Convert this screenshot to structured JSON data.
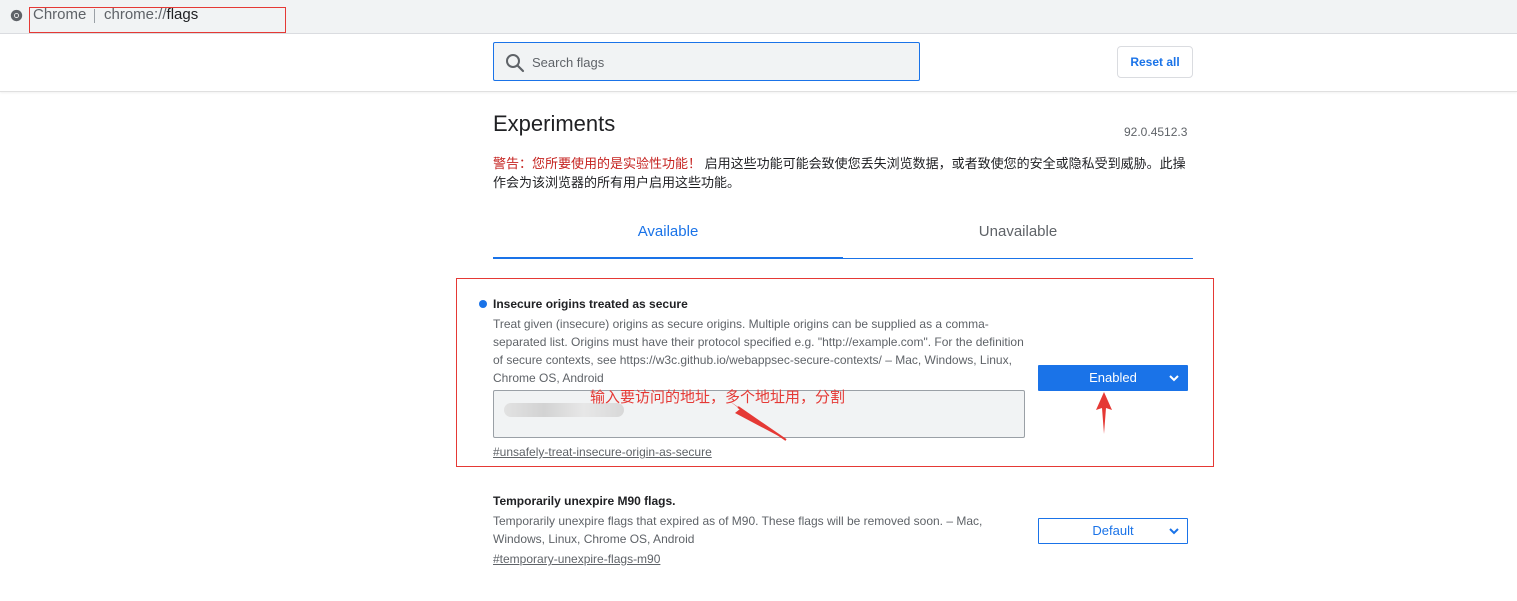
{
  "address_bar": {
    "site_label": "Chrome",
    "url_scheme": "chrome://",
    "url_path": "flags"
  },
  "search": {
    "placeholder": "Search flags",
    "value": ""
  },
  "header": {
    "reset_label": "Reset all"
  },
  "page": {
    "title": "Experiments",
    "version": "92.0.4512.3",
    "warning_lead": "警告：您所要使用的是实验性功能！",
    "warning_body": " 启用这些功能可能会致使您丢失浏览数据，或者致使您的安全或隐私受到威胁。此操作会为该浏览器的所有用户启用这些功能。"
  },
  "tabs": [
    {
      "label": "Available",
      "active": true
    },
    {
      "label": "Unavailable",
      "active": false
    }
  ],
  "flags": [
    {
      "name": "Insecure origins treated as secure",
      "description": "Treat given (insecure) origins as secure origins. Multiple origins can be supplied as a comma-separated list. Origins must have their protocol specified e.g. \"http://example.com\". For the definition of secure contexts, see https://w3c.github.io/webappsec-secure-contexts/ – Mac, Windows, Linux, Chrome OS, Android",
      "link": "#unsafely-treat-insecure-origin-as-secure",
      "state": "Enabled",
      "modified": true
    },
    {
      "name": "Temporarily unexpire M90 flags.",
      "description": "Temporarily unexpire flags that expired as of M90. These flags will be removed soon. – Mac, Windows, Linux, Chrome OS, Android",
      "link": "#temporary-unexpire-flags-m90",
      "state": "Default",
      "modified": false
    }
  ],
  "annotation": {
    "text": "输入要访问的地址，多个地址用，分割"
  },
  "colors": {
    "accent": "#1a73e8",
    "annotation": "#e53935",
    "warning": "#c5221f"
  }
}
